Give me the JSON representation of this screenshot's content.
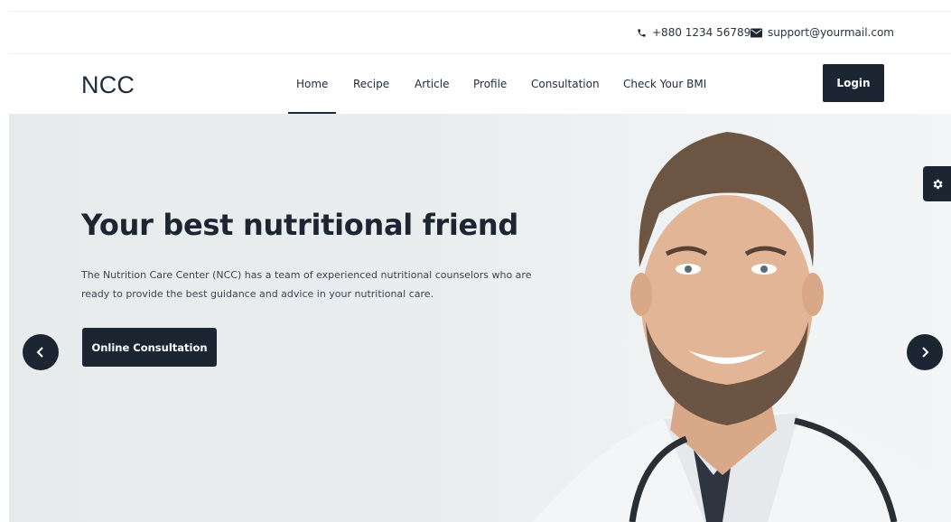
{
  "topbar": {
    "phone": "+880 1234 56789",
    "phone_icon": "phone-icon",
    "email": "support@yourmail.com",
    "email_icon": "envelope-icon"
  },
  "navbar": {
    "logo": "NCC",
    "links": [
      {
        "label": "Home",
        "active": true
      },
      {
        "label": "Recipe",
        "active": false
      },
      {
        "label": "Article",
        "active": false
      },
      {
        "label": "Profile",
        "active": false
      },
      {
        "label": "Consultation",
        "active": false
      },
      {
        "label": "Check Your BMI",
        "active": false
      }
    ],
    "login_label": "Login"
  },
  "hero": {
    "title": "Your best nutritional friend",
    "description_line1": "The Nutrition Care Center (NCC) has a team of experienced nutritional counselors who are",
    "description_line2": "ready to provide the best guidance and advice in your nutritional care.",
    "cta_label": "Online Consultation",
    "prev_icon": "chevron-left-icon",
    "next_icon": "chevron-right-icon"
  },
  "settings": {
    "icon": "gear-icon"
  },
  "colors": {
    "primary": "#1c2633",
    "hero_bg": "#e9edee",
    "text": "#1e2a3a"
  }
}
